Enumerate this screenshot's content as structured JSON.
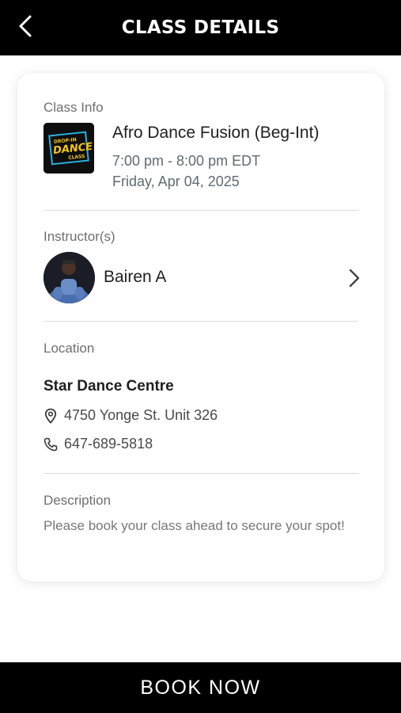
{
  "header": {
    "title": "CLASS DETAILS",
    "back_icon": "chevron-left-icon"
  },
  "class_info": {
    "section_label": "Class Info",
    "name": "Afro Dance Fusion (Beg-Int)",
    "time": "7:00 pm - 8:00 pm EDT",
    "date": "Friday, Apr 04, 2025",
    "thumbnail": {
      "line1": "DROP-IN",
      "line2": "DANCE",
      "line3": "CLASS",
      "accent_color": "#f5c518",
      "border_color": "#2ab0e0"
    }
  },
  "instructor": {
    "section_label": "Instructor(s)",
    "name": "Bairen A",
    "chevron_icon": "chevron-right-icon"
  },
  "location": {
    "section_label": "Location",
    "name": "Star Dance Centre",
    "address": "4750 Yonge St. Unit 326",
    "address_icon": "map-pin-icon",
    "phone": "647-689-5818",
    "phone_icon": "phone-icon"
  },
  "description": {
    "section_label": "Description",
    "text": "Please book your class ahead to secure your spot!"
  },
  "footer": {
    "book_label": "BOOK NOW"
  }
}
